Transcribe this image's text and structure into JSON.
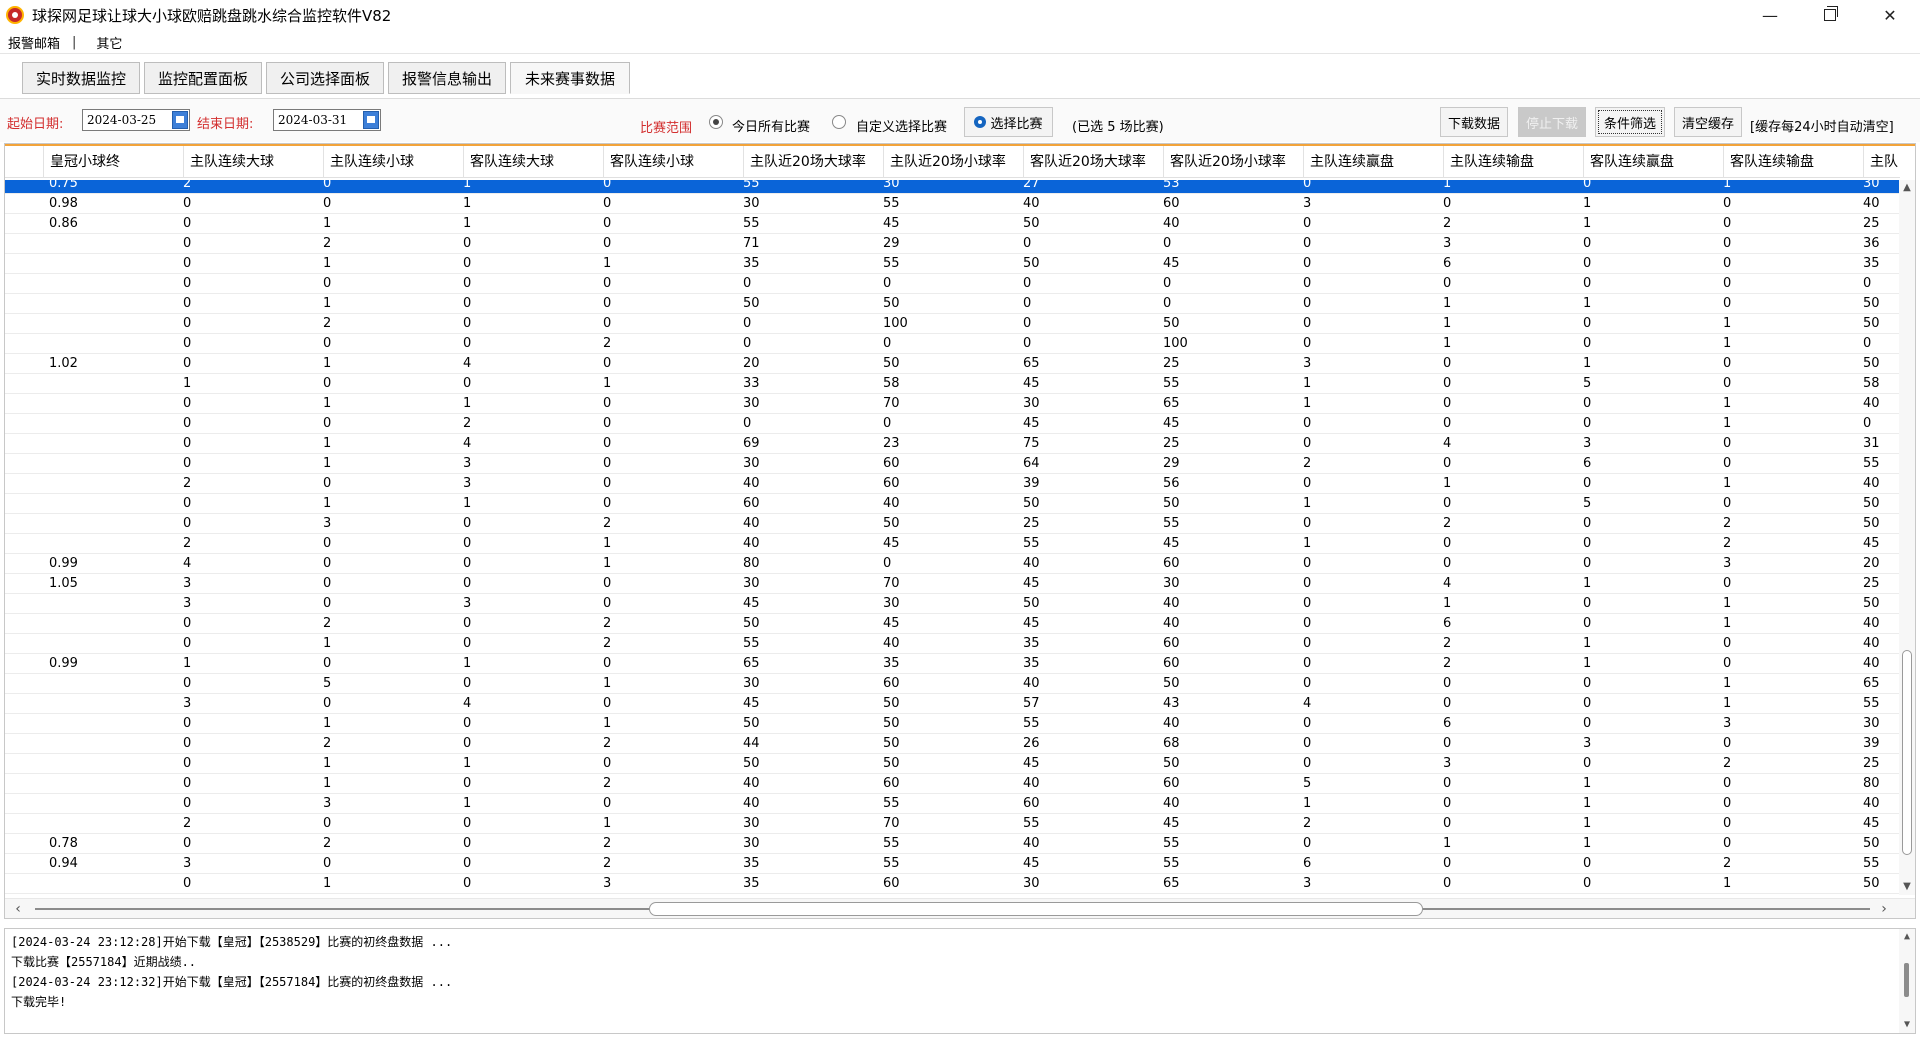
{
  "window": {
    "title": "球探网足球让球大小球欧赔跳盘跳水综合监控软件V82"
  },
  "menu": {
    "items": [
      "报警邮箱",
      "其它"
    ],
    "separator": "|"
  },
  "tabs": [
    "实时数据监控",
    "监控配置面板",
    "公司选择面板",
    "报警信息输出",
    "未来赛事数据"
  ],
  "active_tab": "未来赛事数据",
  "toolbar": {
    "start_label": "起始日期:",
    "start_value": "2024-03-25",
    "end_label": "结束日期:",
    "end_value": "2024-03-31",
    "range_label": "比赛范围",
    "radio_all": "今日所有比赛",
    "radio_custom": "自定义选择比赛",
    "select_match": "选择比赛",
    "selected_info": "(已选 5 场比赛)",
    "download": "下载数据",
    "stop_download": "停止下载",
    "filter": "条件筛选",
    "clear_cache": "清空缓存",
    "cache_note": "[缓存每24小时自动清空]"
  },
  "table": {
    "columns": [
      "皇冠小球终",
      "主队连续大球",
      "主队连续小球",
      "客队连续大球",
      "客队连续小球",
      "主队近20场大球率",
      "主队近20场小球率",
      "客队近20场大球率",
      "客队近20场小球率",
      "主队连续赢盘",
      "主队连续输盘",
      "客队连续赢盘",
      "客队连续输盘",
      "主队"
    ],
    "rows": [
      [
        "0.75",
        "2",
        "0",
        "1",
        "0",
        "55",
        "30",
        "27",
        "53",
        "0",
        "1",
        "0",
        "1",
        "30"
      ],
      [
        "0.98",
        "0",
        "0",
        "1",
        "0",
        "30",
        "55",
        "40",
        "60",
        "3",
        "0",
        "1",
        "0",
        "40"
      ],
      [
        "0.86",
        "0",
        "1",
        "1",
        "0",
        "55",
        "45",
        "50",
        "40",
        "0",
        "2",
        "1",
        "0",
        "25"
      ],
      [
        "",
        "0",
        "2",
        "0",
        "0",
        "71",
        "29",
        "0",
        "0",
        "0",
        "3",
        "0",
        "0",
        "36"
      ],
      [
        "",
        "0",
        "1",
        "0",
        "1",
        "35",
        "55",
        "50",
        "45",
        "0",
        "6",
        "0",
        "0",
        "35"
      ],
      [
        "",
        "0",
        "0",
        "0",
        "0",
        "0",
        "0",
        "0",
        "0",
        "0",
        "0",
        "0",
        "0",
        "0"
      ],
      [
        "",
        "0",
        "1",
        "0",
        "0",
        "50",
        "50",
        "0",
        "0",
        "0",
        "1",
        "1",
        "0",
        "50"
      ],
      [
        "",
        "0",
        "2",
        "0",
        "0",
        "0",
        "100",
        "0",
        "50",
        "0",
        "1",
        "0",
        "1",
        "50"
      ],
      [
        "",
        "0",
        "0",
        "0",
        "2",
        "0",
        "0",
        "0",
        "100",
        "0",
        "1",
        "0",
        "1",
        "0"
      ],
      [
        "1.02",
        "0",
        "1",
        "4",
        "0",
        "20",
        "50",
        "65",
        "25",
        "3",
        "0",
        "1",
        "0",
        "50"
      ],
      [
        "",
        "1",
        "0",
        "0",
        "1",
        "33",
        "58",
        "45",
        "55",
        "1",
        "0",
        "5",
        "0",
        "58"
      ],
      [
        "",
        "0",
        "1",
        "1",
        "0",
        "30",
        "70",
        "30",
        "65",
        "1",
        "0",
        "0",
        "1",
        "40"
      ],
      [
        "",
        "0",
        "0",
        "2",
        "0",
        "0",
        "0",
        "45",
        "45",
        "0",
        "0",
        "0",
        "1",
        "0"
      ],
      [
        "",
        "0",
        "1",
        "4",
        "0",
        "69",
        "23",
        "75",
        "25",
        "0",
        "4",
        "3",
        "0",
        "31"
      ],
      [
        "",
        "0",
        "1",
        "3",
        "0",
        "30",
        "60",
        "64",
        "29",
        "2",
        "0",
        "6",
        "0",
        "55"
      ],
      [
        "",
        "2",
        "0",
        "3",
        "0",
        "40",
        "60",
        "39",
        "56",
        "0",
        "1",
        "0",
        "1",
        "40"
      ],
      [
        "",
        "0",
        "1",
        "1",
        "0",
        "60",
        "40",
        "50",
        "50",
        "1",
        "0",
        "5",
        "0",
        "50"
      ],
      [
        "",
        "0",
        "3",
        "0",
        "2",
        "40",
        "50",
        "25",
        "55",
        "0",
        "2",
        "0",
        "2",
        "50"
      ],
      [
        "",
        "2",
        "0",
        "0",
        "1",
        "40",
        "45",
        "55",
        "45",
        "1",
        "0",
        "0",
        "2",
        "45"
      ],
      [
        "0.99",
        "4",
        "0",
        "0",
        "1",
        "80",
        "0",
        "40",
        "60",
        "0",
        "0",
        "0",
        "3",
        "20"
      ],
      [
        "1.05",
        "3",
        "0",
        "0",
        "0",
        "30",
        "70",
        "45",
        "30",
        "0",
        "4",
        "1",
        "0",
        "25"
      ],
      [
        "",
        "3",
        "0",
        "3",
        "0",
        "45",
        "30",
        "50",
        "40",
        "0",
        "1",
        "0",
        "1",
        "50"
      ],
      [
        "",
        "0",
        "2",
        "0",
        "2",
        "50",
        "45",
        "45",
        "40",
        "0",
        "6",
        "0",
        "1",
        "40"
      ],
      [
        "",
        "0",
        "1",
        "0",
        "2",
        "55",
        "40",
        "35",
        "60",
        "0",
        "2",
        "1",
        "0",
        "40"
      ],
      [
        "0.99",
        "1",
        "0",
        "1",
        "0",
        "65",
        "35",
        "35",
        "60",
        "0",
        "2",
        "1",
        "0",
        "40"
      ],
      [
        "",
        "0",
        "5",
        "0",
        "1",
        "30",
        "60",
        "40",
        "50",
        "0",
        "0",
        "0",
        "1",
        "65"
      ],
      [
        "",
        "3",
        "0",
        "4",
        "0",
        "45",
        "50",
        "57",
        "43",
        "4",
        "0",
        "0",
        "1",
        "55"
      ],
      [
        "",
        "0",
        "1",
        "0",
        "1",
        "50",
        "50",
        "55",
        "40",
        "0",
        "6",
        "0",
        "3",
        "30"
      ],
      [
        "",
        "0",
        "2",
        "0",
        "2",
        "44",
        "50",
        "26",
        "68",
        "0",
        "0",
        "3",
        "0",
        "39"
      ],
      [
        "",
        "0",
        "1",
        "1",
        "0",
        "50",
        "50",
        "45",
        "50",
        "0",
        "3",
        "0",
        "2",
        "25"
      ],
      [
        "",
        "0",
        "1",
        "0",
        "2",
        "40",
        "60",
        "40",
        "60",
        "5",
        "0",
        "1",
        "0",
        "80"
      ],
      [
        "",
        "0",
        "3",
        "1",
        "0",
        "40",
        "55",
        "60",
        "40",
        "1",
        "0",
        "1",
        "0",
        "40"
      ],
      [
        "",
        "2",
        "0",
        "0",
        "1",
        "30",
        "70",
        "55",
        "45",
        "2",
        "0",
        "1",
        "0",
        "45"
      ],
      [
        "0.78",
        "0",
        "2",
        "0",
        "2",
        "30",
        "55",
        "40",
        "55",
        "0",
        "1",
        "1",
        "0",
        "50"
      ],
      [
        "0.94",
        "3",
        "0",
        "0",
        "2",
        "35",
        "55",
        "45",
        "55",
        "6",
        "0",
        "0",
        "2",
        "55"
      ],
      [
        "",
        "0",
        "1",
        "0",
        "3",
        "35",
        "60",
        "30",
        "65",
        "3",
        "0",
        "0",
        "1",
        "50"
      ]
    ],
    "selected_row": 0
  },
  "log": {
    "lines": [
      "[2024-03-24 23:12:28]开始下载【皇冠】【2538529】比赛的初终盘数据 ...",
      "下载比赛【2557184】近期战绩..",
      "[2024-03-24 23:12:32]开始下载【皇冠】【2557184】比赛的初终盘数据 ...",
      "下载完毕!"
    ]
  },
  "colors": {
    "selected_row": "#0a64d8",
    "label_red": "#d32f2f",
    "header_accent": "#f2a33a"
  },
  "icons": {
    "app": "football-icon",
    "calendar": "calendar-icon",
    "select_match": "gear-icon"
  }
}
